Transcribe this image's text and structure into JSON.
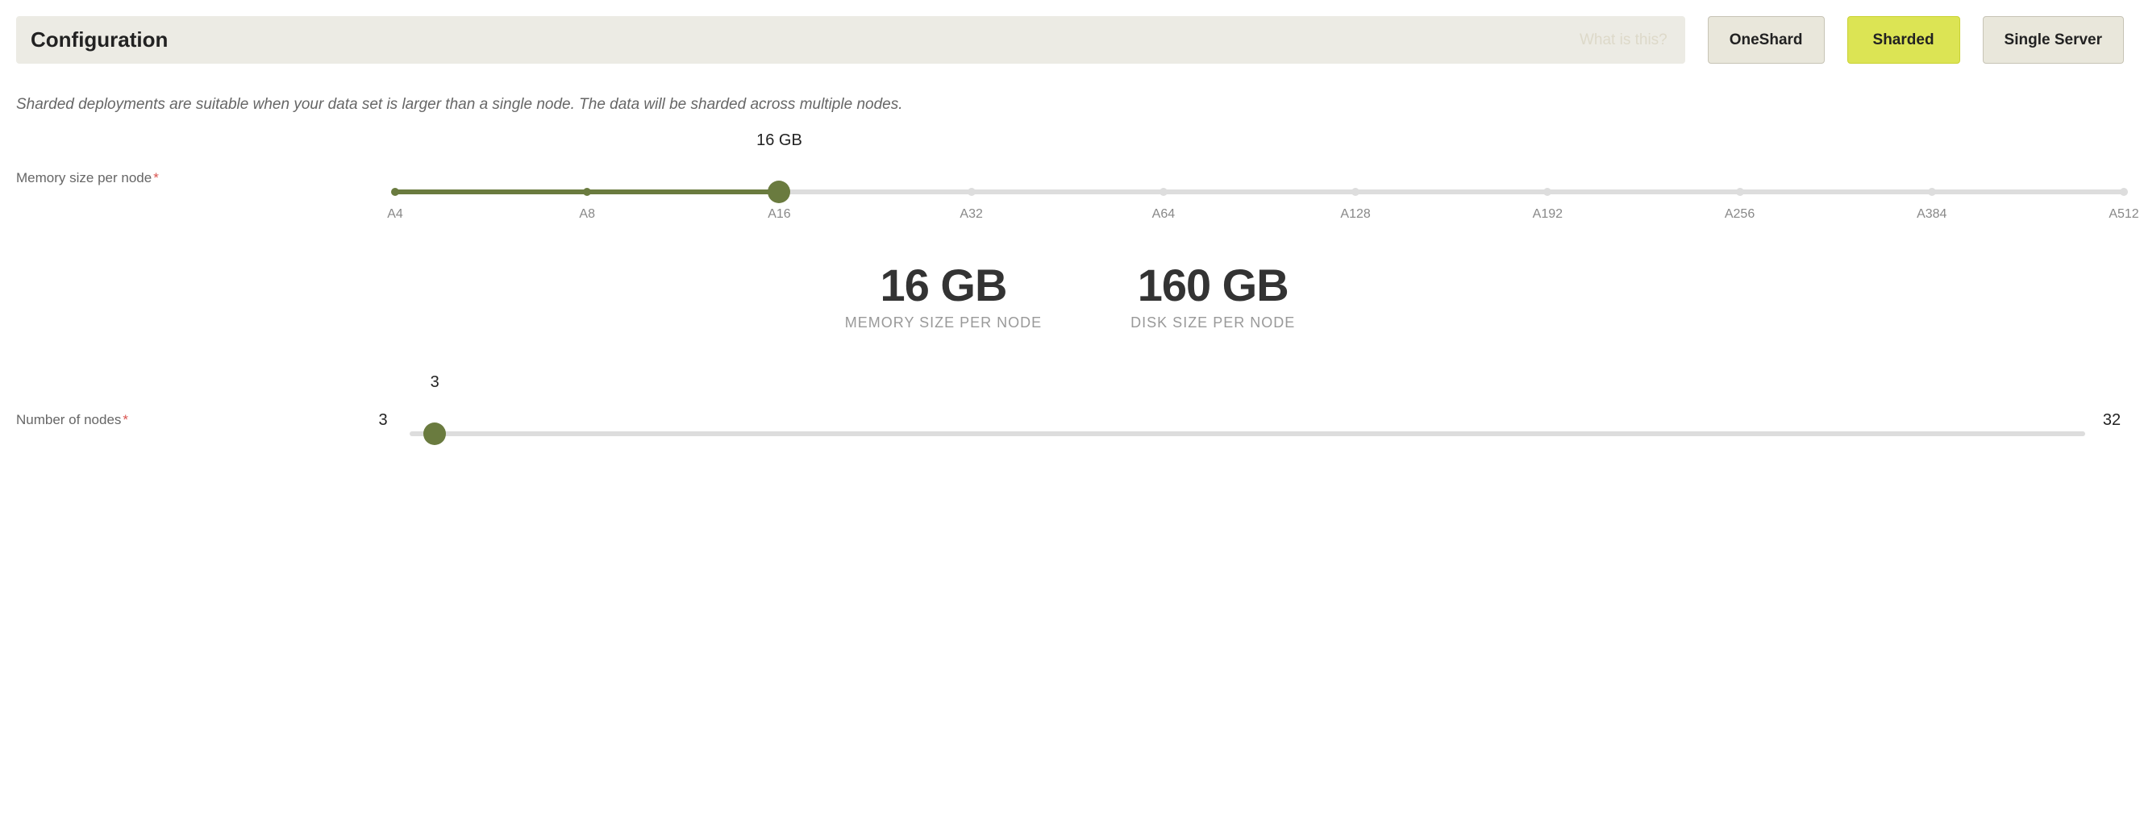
{
  "header": {
    "title": "Configuration",
    "hint": "What is this?"
  },
  "modes": {
    "oneshard": "OneShard",
    "sharded": "Sharded",
    "single": "Single Server"
  },
  "description": "Sharded deployments are suitable when your data set is larger than a single node. The data will be sharded across multiple nodes.",
  "memory": {
    "label": "Memory size per node",
    "value_label": "16 GB",
    "ticks": [
      "A4",
      "A8",
      "A16",
      "A32",
      "A64",
      "A128",
      "A192",
      "A256",
      "A384",
      "A512"
    ],
    "selected_index": 2
  },
  "summary": {
    "memory_value": "16 GB",
    "memory_caption": "MEMORY SIZE PER NODE",
    "disk_value": "160 GB",
    "disk_caption": "DISK SIZE PER NODE"
  },
  "nodes": {
    "label": "Number of nodes",
    "min": "3",
    "max": "32",
    "value": "3"
  }
}
